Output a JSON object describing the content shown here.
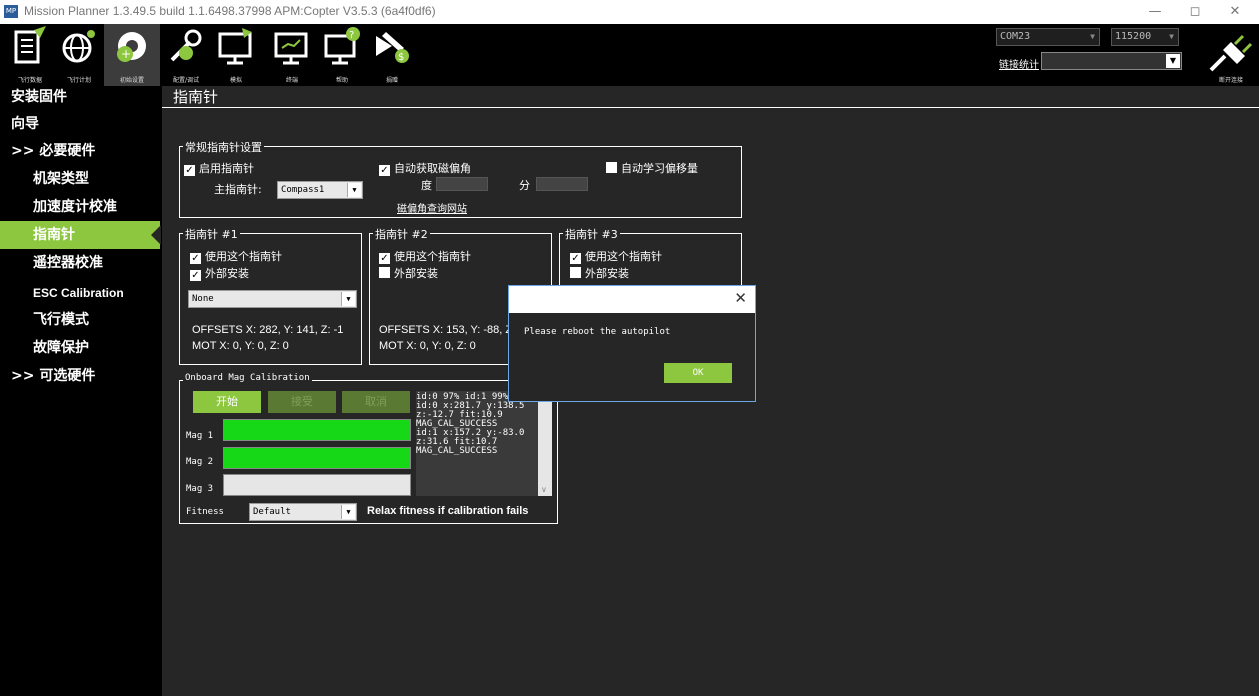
{
  "window": {
    "title": "Mission Planner 1.3.49.5 build 1.1.6498.37998 APM:Copter V3.5.3 (6a4f0df6)",
    "app_icon": "MP",
    "min": "—",
    "max": "◻",
    "close": "✕"
  },
  "toolbar": {
    "items": [
      {
        "label": "飞行数据",
        "icon": "flight-data-icon"
      },
      {
        "label": "飞行计划",
        "icon": "flight-plan-icon"
      },
      {
        "label": "初始设置",
        "icon": "initial-setup-icon"
      },
      {
        "label": "配置/调试",
        "icon": "config-tuning-icon"
      },
      {
        "label": "模拟",
        "icon": "simulation-icon"
      },
      {
        "label": "终端",
        "icon": "terminal-icon"
      },
      {
        "label": "帮助",
        "icon": "help-icon"
      },
      {
        "label": "捐赠",
        "icon": "donate-icon"
      }
    ],
    "port": "COM23",
    "baud": "115200",
    "link_stats": "链接统计",
    "connect_label": "断开连接"
  },
  "sidebar": {
    "items": [
      {
        "label": "安装固件",
        "type": "top"
      },
      {
        "label": "向导",
        "type": "top"
      },
      {
        "label": ">> 必要硬件",
        "type": "top"
      },
      {
        "label": "机架类型",
        "type": "sub"
      },
      {
        "label": "加速度计校准",
        "type": "sub"
      },
      {
        "label": "指南针",
        "type": "sub",
        "active": true
      },
      {
        "label": "遥控器校准",
        "type": "sub"
      },
      {
        "label": "ESC Calibration",
        "type": "sub"
      },
      {
        "label": "飞行模式",
        "type": "sub"
      },
      {
        "label": "故障保护",
        "type": "sub"
      },
      {
        "label": ">> 可选硬件",
        "type": "top"
      }
    ]
  },
  "page": {
    "title": "指南针",
    "general": {
      "legend": "常规指南针设置",
      "enable_compass": "启用指南针",
      "auto_declination": "自动获取磁偏角",
      "learn_offsets": "自动学习偏移量",
      "primary_label": "主指南针:",
      "primary_value": "Compass1",
      "deg_label": "度",
      "min_label": "分",
      "declination_link": "磁偏角查询网站"
    },
    "compass1": {
      "legend": "指南针 #1",
      "use": "使用这个指南针",
      "external": "外部安装",
      "orientation": "None",
      "offsets": "OFFSETS X: 282,  Y: 141,  Z: -1",
      "mot": "MOT      X: 0,  Y: 0,  Z: 0"
    },
    "compass2": {
      "legend": "指南针 #2",
      "use": "使用这个指南针",
      "external": "外部安装",
      "offsets": "OFFSETS X: 153,  Y: -88,  Z",
      "mot": "MOT      X: 0,  Y: 0,  Z: 0"
    },
    "compass3": {
      "legend": "指南针 #3",
      "use": "使用这个指南针",
      "external": "外部安装"
    },
    "onboard": {
      "legend": "Onboard Mag Calibration",
      "start": "开始",
      "accept": "接受",
      "cancel": "取消",
      "mag1": "Mag 1",
      "mag2": "Mag 2",
      "mag3": "Mag 3",
      "mag1_progress": 1.0,
      "mag2_progress": 1.0,
      "mag3_progress": 0.0,
      "fitness_label": "Fitness",
      "fitness_value": "Default",
      "relax_label": "Relax fitness if calibration fails",
      "log": [
        "id:0 97% id:1 99%",
        "id:0 x:281.7 y:138.5",
        "z:-12.7 fit:10.9",
        "MAG_CAL_SUCCESS",
        "id:1 x:157.2 y:-83.0",
        "z:31.6 fit:10.7",
        "MAG_CAL_SUCCESS"
      ]
    }
  },
  "dialog": {
    "message": "Please reboot the autopilot",
    "ok": "OK",
    "close": "✕"
  },
  "colors": {
    "accent_green": "#8dc63f",
    "progress_green": "#16d816",
    "background": "#262626"
  }
}
